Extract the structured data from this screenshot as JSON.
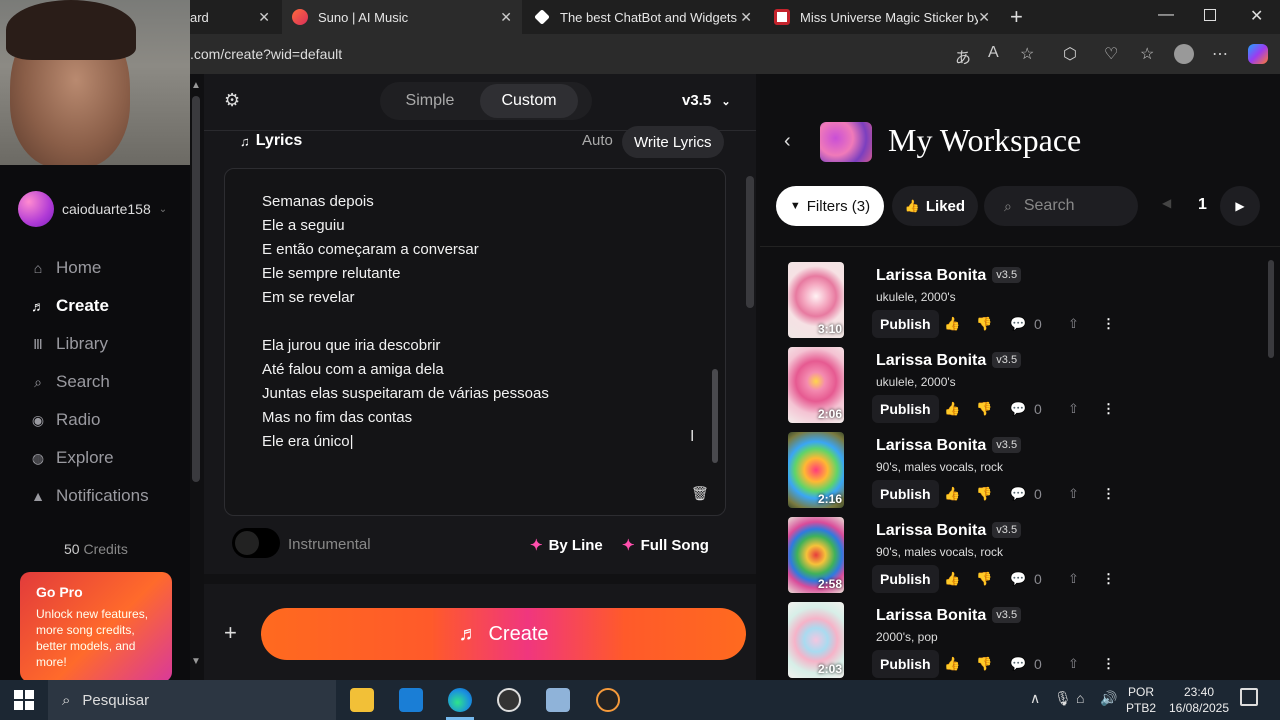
{
  "browser": {
    "tabs": [
      {
        "title": "ard"
      },
      {
        "title": "Suno | AI Music"
      },
      {
        "title": "The best ChatBot and Widgets fo"
      },
      {
        "title": "Miss Universe Magic Sticker by ch"
      }
    ],
    "url": ".com/create?wid=default"
  },
  "sidebar": {
    "username": "caioduarte158",
    "items": [
      {
        "label": "Home",
        "icon": "home-icon"
      },
      {
        "label": "Create",
        "icon": "music-note-icon"
      },
      {
        "label": "Library",
        "icon": "library-icon"
      },
      {
        "label": "Search",
        "icon": "search-icon"
      },
      {
        "label": "Radio",
        "icon": "radio-icon"
      },
      {
        "label": "Explore",
        "icon": "explore-icon"
      },
      {
        "label": "Notifications",
        "icon": "bell-icon"
      }
    ],
    "credits_value": "50",
    "credits_label": "Credits",
    "gopro_title": "Go Pro",
    "gopro_desc": "Unlock new features, more song credits, better models, and more!"
  },
  "create": {
    "mode_simple": "Simple",
    "mode_custom": "Custom",
    "version": "v3.5",
    "lyrics_label": "Lyrics",
    "auto_label": "Auto",
    "write_lyrics_label": "Write Lyrics",
    "lyrics_lines": [
      "Semanas depois",
      "Ele a seguiu",
      "E então começaram a conversar",
      "Ele sempre relutante",
      "Em se revelar",
      "",
      "Ela jurou que iria descobrir",
      "Até falou com a amiga dela",
      "Juntas elas suspeitaram de várias pessoas",
      "Mas no fim das contas",
      "Ele era único"
    ],
    "instrumental_label": "Instrumental",
    "byline_label": "By Line",
    "fullsong_label": "Full Song",
    "create_label": "Create"
  },
  "workspace": {
    "title": "My Workspace",
    "filters_label": "Filters (3)",
    "liked_label": "Liked",
    "search_placeholder": "Search",
    "page": "1",
    "songs": [
      {
        "title": "Larissa Bonita",
        "version": "v3.5",
        "tags": "ukulele, 2000's",
        "duration": "3:10",
        "publish": "Publish",
        "comments": "0"
      },
      {
        "title": "Larissa Bonita",
        "version": "v3.5",
        "tags": "ukulele, 2000's",
        "duration": "2:06",
        "publish": "Publish",
        "comments": "0"
      },
      {
        "title": "Larissa Bonita",
        "version": "v3.5",
        "tags": "90's, males vocals, rock",
        "duration": "2:16",
        "publish": "Publish",
        "comments": "0"
      },
      {
        "title": "Larissa Bonita",
        "version": "v3.5",
        "tags": "90's, males vocals, rock",
        "duration": "2:58",
        "publish": "Publish",
        "comments": "0"
      },
      {
        "title": "Larissa Bonita",
        "version": "v3.5",
        "tags": "2000's, pop",
        "duration": "2:03",
        "publish": "Publish",
        "comments": "0"
      }
    ]
  },
  "taskbar": {
    "search_placeholder": "Pesquisar",
    "lang1": "POR",
    "lang2": "PTB2",
    "time": "23:40",
    "date": "16/08/2025"
  }
}
